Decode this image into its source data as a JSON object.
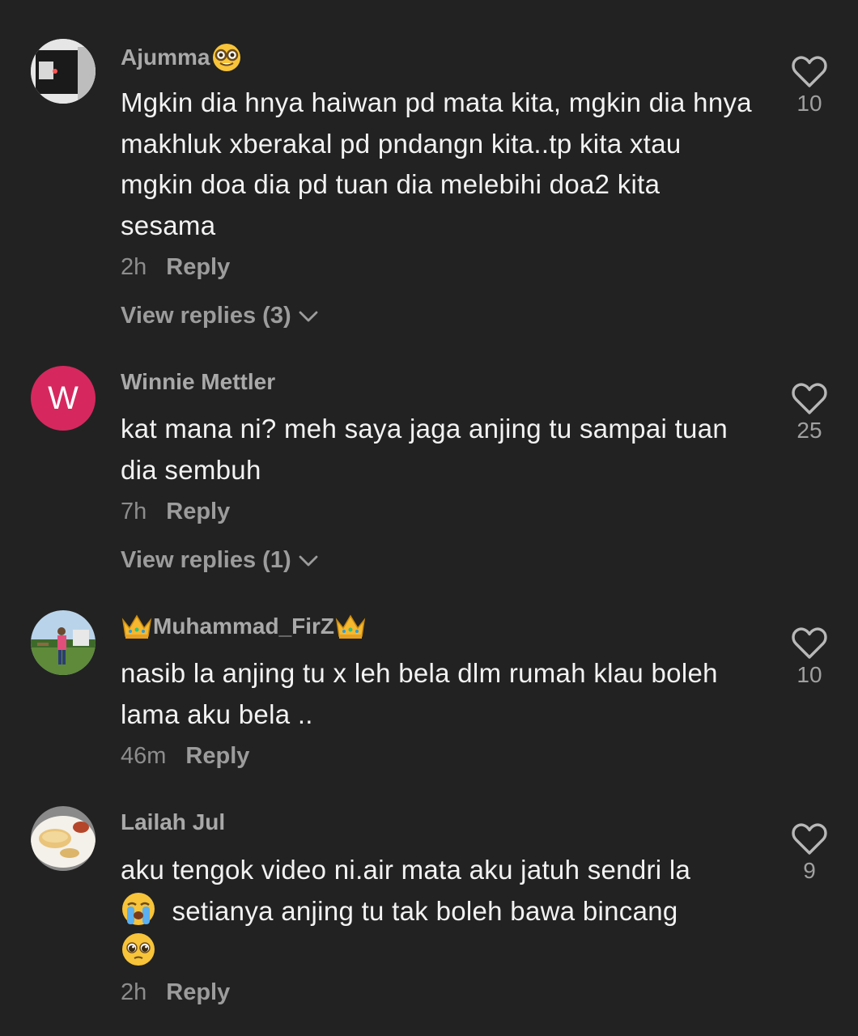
{
  "comments": [
    {
      "username": "Ajumma",
      "username_suffix_icon": "nerd-face-emoji",
      "avatar_icon": "photo-avatar",
      "text": "Mgkin dia hnya haiwan pd mata kita, mgkin dia hnya makhluk xberakal pd pndangn kita..tp kita xtau mgkin doa dia pd tuan dia melebihi doa2 kita sesama",
      "time": "2h",
      "reply_label": "Reply",
      "view_replies": "View replies (3)",
      "likes": "10"
    },
    {
      "username": "Winnie Mettler",
      "avatar_letter": "W",
      "avatar_color": "#d6285e",
      "text": "kat mana ni? meh saya jaga anjing tu sampai tuan dia sembuh",
      "time": "7h",
      "reply_label": "Reply",
      "view_replies": "View replies (1)",
      "likes": "25"
    },
    {
      "username": "Muhammad_FirZ",
      "username_prefix_icon": "crown-emoji",
      "username_suffix_icon": "crown-emoji",
      "avatar_icon": "photo-avatar",
      "text": "nasib la anjing tu x leh bela dlm rumah klau boleh lama aku bela ..",
      "time": "46m",
      "reply_label": "Reply",
      "likes": "10"
    },
    {
      "username": "Lailah Jul",
      "avatar_icon": "photo-avatar",
      "text_line1": "aku tengok video ni.air mata aku jatuh sendri la",
      "text_line2": "setianya anjing tu tak boleh bawa bincang",
      "text_emoji1": "loudly-crying-face-emoji",
      "text_emoji2": "pleading-face-emoji",
      "time": "2h",
      "reply_label": "Reply",
      "likes": "9"
    }
  ],
  "colors": {
    "background": "#222222",
    "text": "#f2f2f2",
    "muted": "#8d8d8d",
    "username": "#a9a9a9",
    "avatar_w": "#d6285e"
  }
}
